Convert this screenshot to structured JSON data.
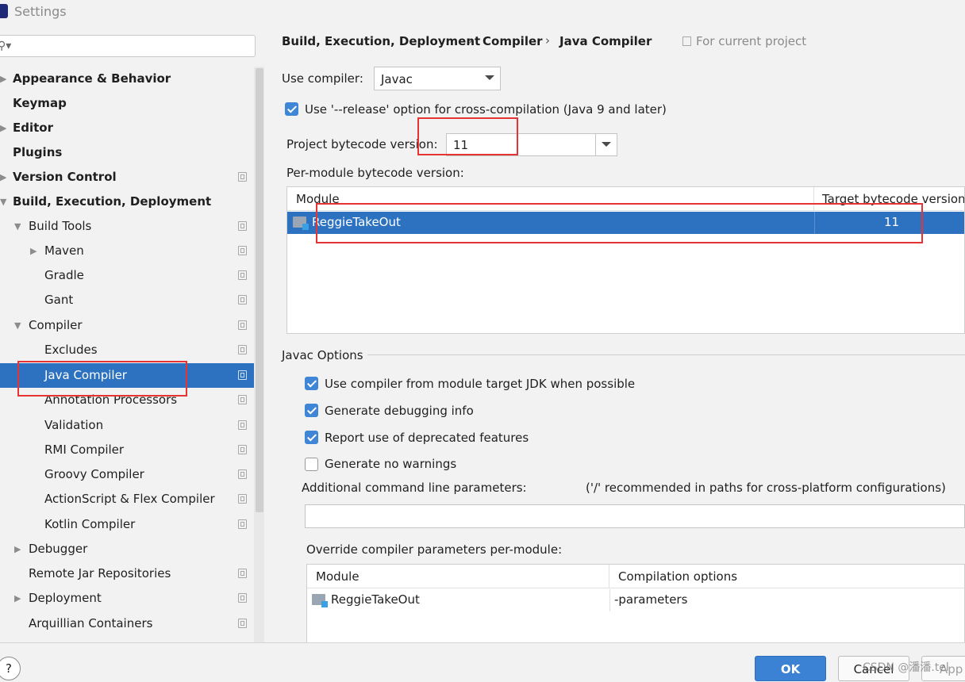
{
  "window": {
    "title": "Settings"
  },
  "sidebar": {
    "search_placeholder": "",
    "items": [
      {
        "label": "Appearance & Behavior"
      },
      {
        "label": "Keymap"
      },
      {
        "label": "Editor"
      },
      {
        "label": "Plugins"
      },
      {
        "label": "Version Control"
      },
      {
        "label": "Build, Execution, Deployment"
      },
      {
        "label": "Build Tools"
      },
      {
        "label": "Maven"
      },
      {
        "label": "Gradle"
      },
      {
        "label": "Gant"
      },
      {
        "label": "Compiler"
      },
      {
        "label": "Excludes"
      },
      {
        "label": "Java Compiler"
      },
      {
        "label": "Annotation Processors"
      },
      {
        "label": "Validation"
      },
      {
        "label": "RMI Compiler"
      },
      {
        "label": "Groovy Compiler"
      },
      {
        "label": "ActionScript & Flex Compiler"
      },
      {
        "label": "Kotlin Compiler"
      },
      {
        "label": "Debugger"
      },
      {
        "label": "Remote Jar Repositories"
      },
      {
        "label": "Deployment"
      },
      {
        "label": "Arquillian Containers"
      }
    ]
  },
  "breadcrumb": {
    "part1": "Build, Execution, Deployment",
    "part2": "Compiler",
    "part3": "Java Compiler",
    "separator": "›",
    "scope": "For current project"
  },
  "compiler": {
    "use_compiler_label": "Use compiler:",
    "use_compiler_value": "Javac",
    "release_option_label": "Use '--release' option for cross-compilation (Java 9 and later)",
    "project_bytecode_label": "Project bytecode version:",
    "project_bytecode_value": "11",
    "per_module_label": "Per-module bytecode version:"
  },
  "module_table": {
    "col_module": "Module",
    "col_target": "Target bytecode version",
    "rows": [
      {
        "module": "ReggieTakeOut",
        "target": "11"
      }
    ]
  },
  "javac_options": {
    "section_title": "Javac Options",
    "opt1": "Use compiler from module target JDK when possible",
    "opt2": "Generate debugging info",
    "opt3": "Report use of deprecated features",
    "opt4": "Generate no warnings",
    "additional_label": "Additional command line parameters:",
    "additional_hint": "('/' recommended in paths for cross-platform configurations)",
    "additional_value": "",
    "override_label": "Override compiler parameters per-module:"
  },
  "override_table": {
    "col_module": "Module",
    "col_options": "Compilation options",
    "rows": [
      {
        "module": "ReggieTakeOut",
        "options": "-parameters"
      }
    ]
  },
  "footer": {
    "help": "?",
    "ok": "OK",
    "cancel": "Cancel",
    "apply": "App",
    "watermark": "CSDN @潘潘.tel"
  },
  "colors": {
    "accent": "#2c72c0",
    "highlight_box": "#e63434",
    "checkbox": "#3f86d6"
  }
}
